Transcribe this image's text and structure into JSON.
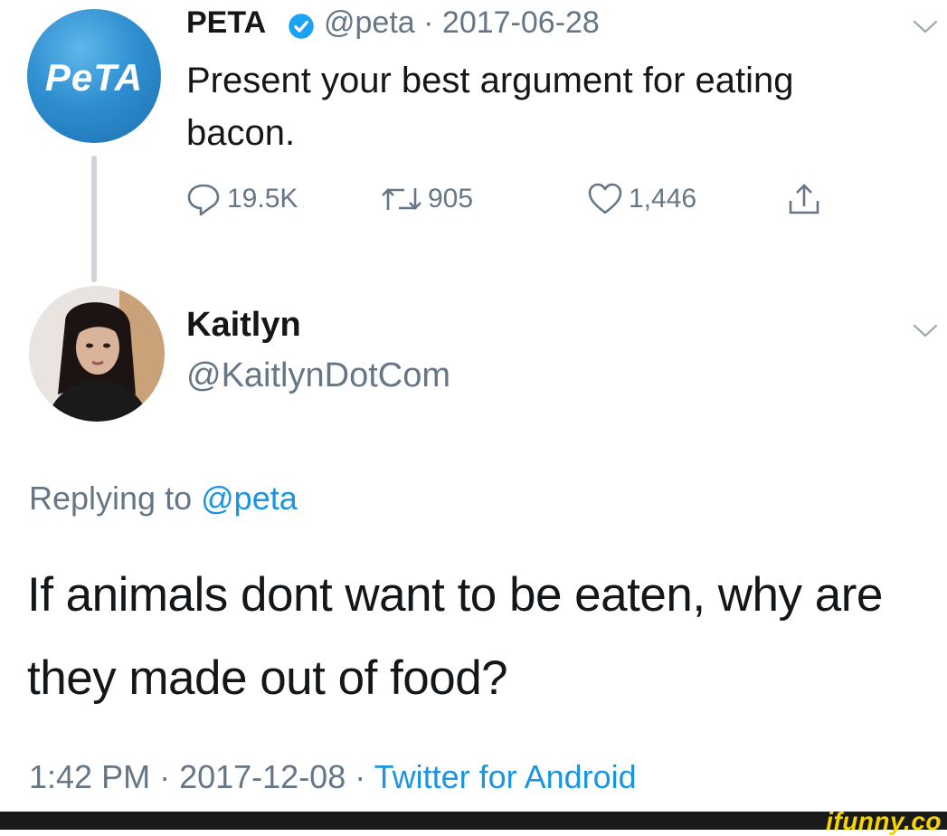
{
  "original_tweet": {
    "avatar_text": "PeTA",
    "name": "PETA",
    "handle": "@peta",
    "date": "2017-06-28",
    "text": "Present your best argument for eating bacon.",
    "actions": {
      "replies": "19.5K",
      "retweets": "905",
      "likes": "1,446"
    }
  },
  "reply_tweet": {
    "name": "Kaitlyn",
    "handle": "@KaitlynDotCom",
    "replying_prefix": "Replying to",
    "replying_mention": "@peta",
    "text": "If animals dont want to be eaten, why are they made out of food?",
    "time": "1:42 PM",
    "date": "2017-12-08",
    "source": "Twitter for Android"
  },
  "watermark": "ifunny.co",
  "colors": {
    "link_blue": "#1b95e0",
    "meta_gray": "#657786",
    "verified_blue": "#1da1f2",
    "watermark_yellow": "#f5d400"
  },
  "icons": [
    "verified-badge-icon",
    "chevron-down-icon",
    "reply-icon",
    "retweet-icon",
    "like-icon",
    "share-icon"
  ]
}
